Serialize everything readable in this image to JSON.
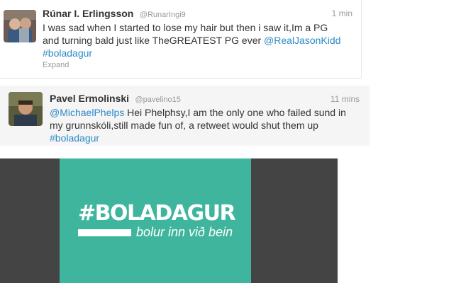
{
  "tweets": [
    {
      "fullname": "Rúnar I. Erlingsson",
      "username": "@RunarIngi9",
      "time": "1 min",
      "lines": [
        "I was sad when I started to lose my hair but then i saw it,Im a PG",
        "and turning bald just like TheGREATEST PG ever",
        "@RealJasonKidd",
        "#boladagur"
      ],
      "expand": "Expand"
    },
    {
      "fullname": "Pavel Ermolinski",
      "username": "@pavelino15",
      "time": "11 mins",
      "lines": [
        "@MichaelPhelps",
        "Hei Phelphsy,I am the only one who failed sund in",
        "my grunnskóli,still made fun of, a retweet would shut them up",
        "#boladagur"
      ]
    }
  ],
  "promo": {
    "title": "#BOLADAGUR",
    "subtitle": "bolur inn við bein"
  },
  "colors": {
    "link": "#2b8ac6",
    "promo_bg": "#3fb59d",
    "promo_frame": "#444444"
  }
}
